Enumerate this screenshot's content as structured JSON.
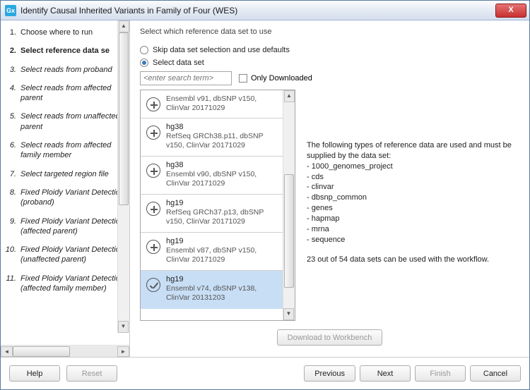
{
  "window": {
    "title": "Identify Causal Inherited Variants in Family of Four (WES)",
    "icon_text": "Gx"
  },
  "steps": [
    {
      "n": "1.",
      "label": "Choose where to run",
      "style": "plain"
    },
    {
      "n": "2.",
      "label": "Select reference data se",
      "style": "bold"
    },
    {
      "n": "3.",
      "label": "Select reads from proband",
      "style": "italic"
    },
    {
      "n": "4.",
      "label": "Select reads from affected parent",
      "style": "italic"
    },
    {
      "n": "5.",
      "label": "Select reads from unaffected parent",
      "style": "italic"
    },
    {
      "n": "6.",
      "label": "Select reads from affected family member",
      "style": "italic"
    },
    {
      "n": "7.",
      "label": "Select targeted region file",
      "style": "italic"
    },
    {
      "n": "8.",
      "label": "Fixed Ploidy Variant Detection (proband)",
      "style": "italic"
    },
    {
      "n": "9.",
      "label": "Fixed Ploidy Variant Detection (affected parent)",
      "style": "italic"
    },
    {
      "n": "10.",
      "label": "Fixed Ploidy Variant Detection (unaffected parent)",
      "style": "italic"
    },
    {
      "n": "11.",
      "label": "Fixed Ploidy Variant Detection (affected family member)",
      "style": "italic"
    }
  ],
  "panel": {
    "prompt": "Select which reference data set to use",
    "radio_skip": "Skip data set selection and use defaults",
    "radio_select": "Select data set",
    "search_placeholder": "<enter search term>",
    "only_downloaded": "Only Downloaded"
  },
  "datasets": [
    {
      "title": "",
      "detail": "Ensembl v91, dbSNP v150, ClinVar 20171029",
      "icon": "plus",
      "partial": true
    },
    {
      "title": "hg38",
      "detail": "RefSeq GRCh38.p11, dbSNP v150, ClinVar 20171029",
      "icon": "plus"
    },
    {
      "title": "hg38",
      "detail": "Ensembl v90, dbSNP v150, ClinVar 20171029",
      "icon": "plus"
    },
    {
      "title": "hg19",
      "detail": "RefSeq GRCh37.p13, dbSNP v150, ClinVar 20171029",
      "icon": "plus"
    },
    {
      "title": "hg19",
      "detail": "Ensembl v87, dbSNP v150, ClinVar 20171029",
      "icon": "plus"
    },
    {
      "title": "hg19",
      "detail": "Ensembl v74, dbSNP v138, ClinVar 20131203",
      "icon": "check",
      "selected": true
    }
  ],
  "info": {
    "intro": "The following types of reference data are used and must be supplied by the data set:",
    "types": [
      "1000_genomes_project",
      "cds",
      "clinvar",
      "dbsnp_common",
      "genes",
      "hapmap",
      "mrna",
      "sequence"
    ],
    "note": "23 out of 54 data sets can be used with the workflow."
  },
  "buttons": {
    "download": "Download to Workbench",
    "help": "Help",
    "reset": "Reset",
    "previous": "Previous",
    "next": "Next",
    "finish": "Finish",
    "cancel": "Cancel"
  }
}
